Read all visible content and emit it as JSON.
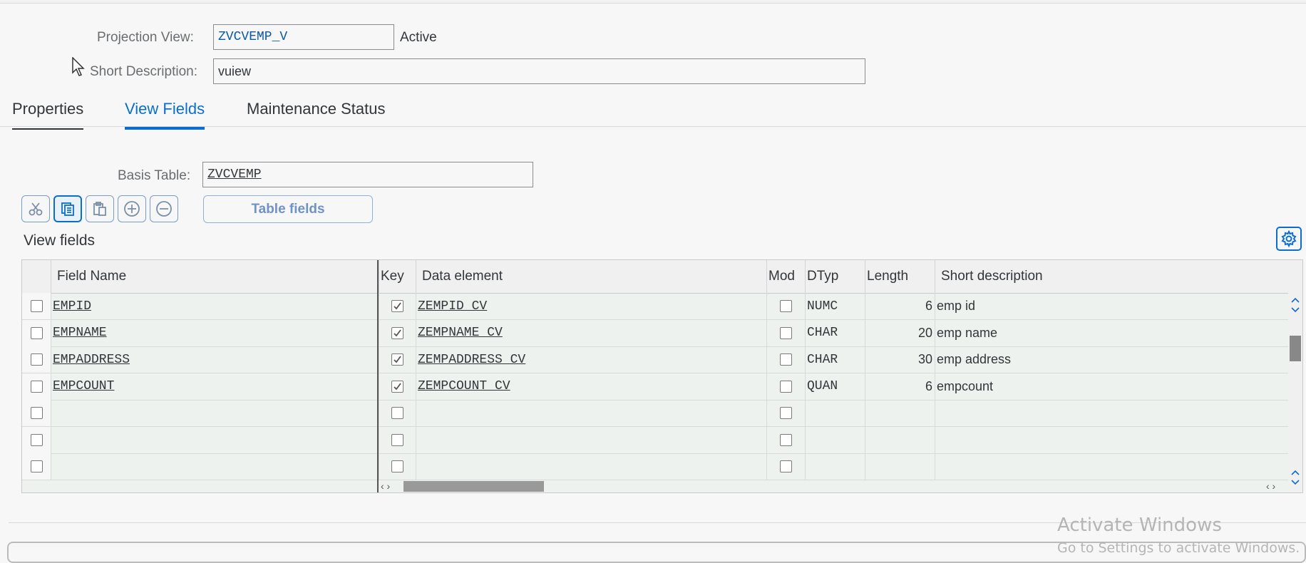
{
  "header": {
    "projection_view_label": "Projection View:",
    "projection_view_value": "ZVCVEMP_V",
    "projection_view_status": "Active",
    "short_description_label": "Short Description:",
    "short_description_value": "vuiew"
  },
  "tabs": [
    {
      "label": "Properties",
      "active": false
    },
    {
      "label": "View Fields",
      "active": true
    },
    {
      "label": "Maintenance Status",
      "active": false
    }
  ],
  "view_fields_tab": {
    "basis_table_label": "Basis Table:",
    "basis_table_value": "ZVCVEMP",
    "toolbar": {
      "icons": [
        "cut-icon",
        "copy-icon",
        "paste-icon",
        "insert-row-icon",
        "delete-row-icon"
      ],
      "table_fields_label": "Table fields"
    },
    "section_title": "View fields",
    "table": {
      "columns": [
        "Field Name",
        "Key",
        "Data element",
        "Mod",
        "DTyp",
        "Length",
        "Short description"
      ],
      "rows": [
        {
          "field_name": "EMPID",
          "key": true,
          "data_element": "ZEMPID_CV",
          "mod": false,
          "dtyp": "NUMC",
          "length": "6",
          "short_description": "emp id"
        },
        {
          "field_name": "EMPNAME",
          "key": true,
          "data_element": "ZEMPNAME_CV",
          "mod": false,
          "dtyp": "CHAR",
          "length": "20",
          "short_description": "emp name"
        },
        {
          "field_name": "EMPADDRESS",
          "key": true,
          "data_element": "ZEMPADDRESS_CV",
          "mod": false,
          "dtyp": "CHAR",
          "length": "30",
          "short_description": "emp address"
        },
        {
          "field_name": "EMPCOUNT",
          "key": true,
          "data_element": "ZEMPCOUNT_CV",
          "mod": false,
          "dtyp": "QUAN",
          "length": "6",
          "short_description": "empcount"
        },
        {
          "field_name": "",
          "key": false,
          "data_element": "",
          "mod": false,
          "dtyp": "",
          "length": "",
          "short_description": ""
        },
        {
          "field_name": "",
          "key": false,
          "data_element": "",
          "mod": false,
          "dtyp": "",
          "length": "",
          "short_description": ""
        },
        {
          "field_name": "",
          "key": false,
          "data_element": "",
          "mod": false,
          "dtyp": "",
          "length": "",
          "short_description": ""
        }
      ]
    }
  },
  "watermark": {
    "line1": "Activate Windows",
    "line2": "Go to Settings to activate Windows."
  },
  "colors": {
    "accent": "#0a6ed1",
    "background": "#f7f7f7",
    "grid_row": "#eef2ef"
  }
}
